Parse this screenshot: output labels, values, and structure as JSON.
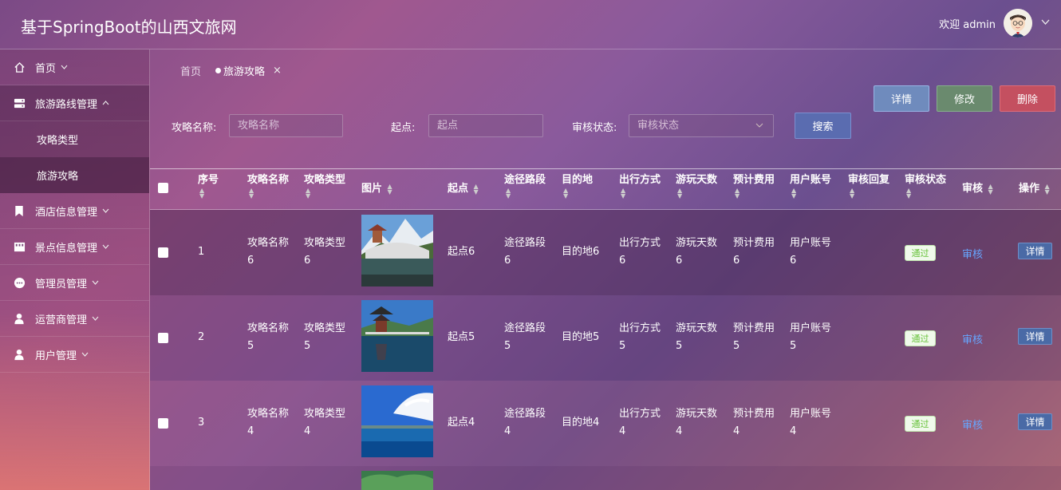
{
  "header": {
    "title": "基于SpringBoot的山西文旅网",
    "welcome": "欢迎 admin"
  },
  "sidebar": {
    "items": [
      {
        "label": "首页",
        "icon": "home-icon"
      },
      {
        "label": "旅游路线管理",
        "icon": "server-icon",
        "open": true
      },
      {
        "label": "酒店信息管理",
        "icon": "bookmark-icon"
      },
      {
        "label": "景点信息管理",
        "icon": "store-icon"
      },
      {
        "label": "管理员管理",
        "icon": "chat-icon"
      },
      {
        "label": "运营商管理",
        "icon": "user-icon"
      },
      {
        "label": "用户管理",
        "icon": "user-icon"
      }
    ],
    "subitems": [
      {
        "label": "攻略类型"
      },
      {
        "label": "旅游攻略",
        "active": true
      }
    ]
  },
  "tabs": {
    "home": "首页",
    "active": "旅游攻略",
    "close": "×"
  },
  "actions": {
    "detail": "详情",
    "edit": "修改",
    "delete": "删除"
  },
  "filters": {
    "name_label": "攻略名称:",
    "name_placeholder": "攻略名称",
    "start_label": "起点:",
    "start_placeholder": "起点",
    "status_label": "审核状态:",
    "status_placeholder": "审核状态",
    "search": "搜索"
  },
  "table": {
    "columns": [
      "序号",
      "攻略名称",
      "攻略类型",
      "图片",
      "起点",
      "途径路段",
      "目的地",
      "出行方式",
      "游玩天数",
      "预计费用",
      "用户账号",
      "审核回复",
      "审核状态",
      "审核",
      "操作"
    ],
    "rows": [
      {
        "idx": "1",
        "name": [
          "攻略名称",
          "6"
        ],
        "type": [
          "攻略类型",
          "6"
        ],
        "start": "起点6",
        "route": [
          "途径路段",
          "6"
        ],
        "dest": "目的地6",
        "mode": [
          "出行方式",
          "6"
        ],
        "days": [
          "游玩天数",
          "6"
        ],
        "cost": [
          "预计费用",
          "6"
        ],
        "account": [
          "用户账号",
          "6"
        ],
        "reply": "",
        "status": "通过",
        "audit": "审核",
        "op": "详情"
      },
      {
        "idx": "2",
        "name": [
          "攻略名称",
          "5"
        ],
        "type": [
          "攻略类型",
          "5"
        ],
        "start": "起点5",
        "route": [
          "途径路段",
          "5"
        ],
        "dest": "目的地5",
        "mode": [
          "出行方式",
          "5"
        ],
        "days": [
          "游玩天数",
          "5"
        ],
        "cost": [
          "预计费用",
          "5"
        ],
        "account": [
          "用户账号",
          "5"
        ],
        "reply": "",
        "status": "通过",
        "audit": "审核",
        "op": "详情"
      },
      {
        "idx": "3",
        "name": [
          "攻略名称",
          "4"
        ],
        "type": [
          "攻略类型",
          "4"
        ],
        "start": "起点4",
        "route": [
          "途径路段",
          "4"
        ],
        "dest": "目的地4",
        "mode": [
          "出行方式",
          "4"
        ],
        "days": [
          "游玩天数",
          "4"
        ],
        "cost": [
          "预计费用",
          "4"
        ],
        "account": [
          "用户账号",
          "4"
        ],
        "reply": "",
        "status": "通过",
        "audit": "审核",
        "op": "详情"
      }
    ]
  },
  "colors": {
    "status_pass": "#67c23a",
    "link": "#66a6ff",
    "detail_btn": "#6f8bbd",
    "edit_btn": "#6a8a6e",
    "delete_btn": "#c45060"
  }
}
